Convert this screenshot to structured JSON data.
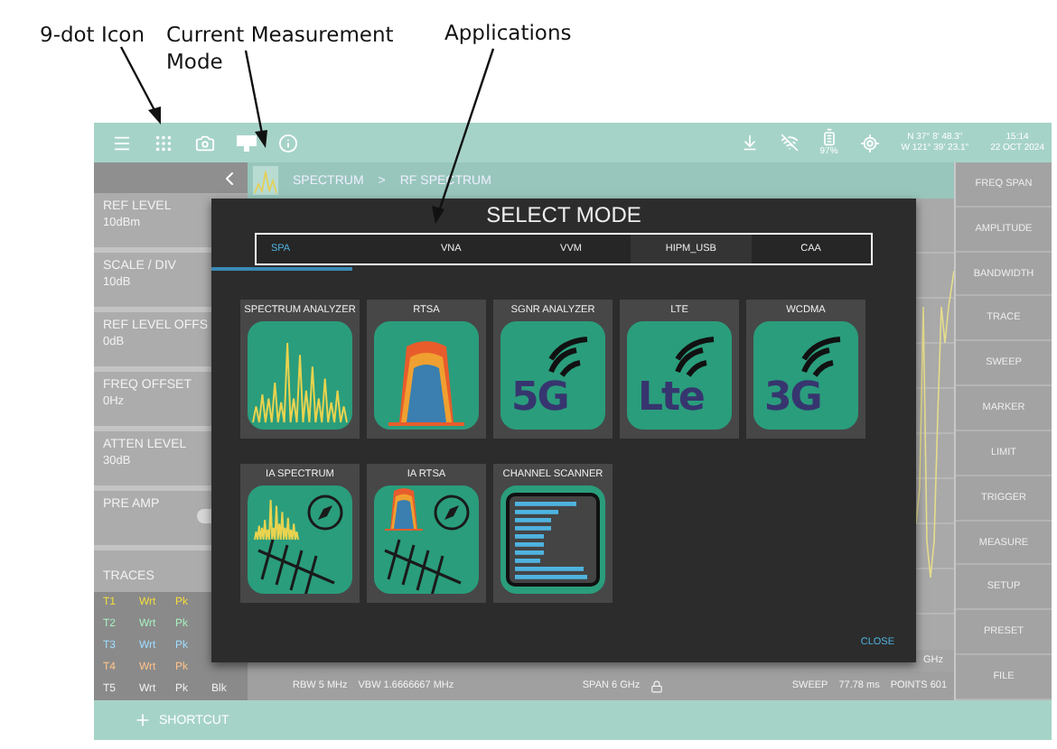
{
  "callouts": [
    {
      "text": "9-dot Icon"
    },
    {
      "text": "Current Measurement Mode"
    },
    {
      "text": "Applications"
    }
  ],
  "top_bar": {
    "battery": "97%",
    "gps": [
      "N 37° 8' 48.3\"",
      "W 121° 39' 23.1\""
    ],
    "time": "15:14",
    "date": "22 OCT 2024"
  },
  "breadcrumb": {
    "mode": "SPECTRUM",
    "separator": ">",
    "measurement": "RF SPECTRUM"
  },
  "settings": [
    {
      "kind": "value",
      "label": "REF LEVEL",
      "value": "10dBm"
    },
    {
      "kind": "value",
      "label": "SCALE / DIV",
      "value": "10dB"
    },
    {
      "kind": "value",
      "label": "REF LEVEL OFFS",
      "value": "0dB"
    },
    {
      "kind": "value",
      "label": "FREQ OFFSET",
      "value": "0Hz"
    },
    {
      "kind": "value",
      "label": "ATTEN LEVEL",
      "value": "30dB"
    },
    {
      "kind": "toggle",
      "label": "PRE AMP",
      "on": false
    }
  ],
  "traces": {
    "title": "TRACES",
    "rows": [
      {
        "cells": [
          "T1",
          "Wrt",
          "Pk"
        ],
        "color": "#f5dc3c"
      },
      {
        "cells": [
          "T2",
          "Wrt",
          "Pk"
        ],
        "color": "#a8f0c0"
      },
      {
        "cells": [
          "T3",
          "Wrt",
          "Pk"
        ],
        "color": "#9fdcff"
      },
      {
        "cells": [
          "T4",
          "Wrt",
          "Pk"
        ],
        "color": "#ffc48a"
      },
      {
        "cells": [
          "T5",
          "Wrt",
          "Pk",
          "Blk"
        ],
        "color": "#f0f0f0"
      }
    ]
  },
  "freq_label": "GHz",
  "status": [
    "RBW 5 MHz",
    "VBW 1.6666667 MHz",
    "SPAN 6 GHz",
    "SWEEP",
    "77.78 ms",
    "POINTS 601"
  ],
  "softkeys": [
    "FREQ SPAN",
    "AMPLITUDE",
    "BANDWIDTH",
    "TRACE",
    "SWEEP",
    "MARKER",
    "LIMIT",
    "TRIGGER",
    "MEASURE",
    "SETUP",
    "PRESET",
    "FILE"
  ],
  "shortcut": "SHORTCUT",
  "dialog": {
    "title": "SELECT MODE",
    "tabs": [
      {
        "label": "SPA",
        "selected": true
      },
      {
        "label": "VNA",
        "selected": false
      },
      {
        "label": "VVM",
        "selected": false
      },
      {
        "label": "HIPM_USB",
        "selected": false
      },
      {
        "label": "CAA",
        "selected": false
      }
    ],
    "tiles": [
      {
        "title": "SPECTRUM ANALYZER",
        "kind": "spectrum"
      },
      {
        "title": "RTSA",
        "kind": "rtsa"
      },
      {
        "title": "SGNR ANALYZER",
        "kind": "logo",
        "logo": "5G"
      },
      {
        "title": "LTE",
        "kind": "logo",
        "logo": "Lte"
      },
      {
        "title": "WCDMA",
        "kind": "logo",
        "logo": "3G"
      },
      {
        "title": "IA SPECTRUM",
        "kind": "ia-spectrum"
      },
      {
        "title": "IA RTSA",
        "kind": "ia-rtsa"
      },
      {
        "title": "CHANNEL SCANNER",
        "kind": "scanner"
      }
    ],
    "close": "CLOSE"
  }
}
